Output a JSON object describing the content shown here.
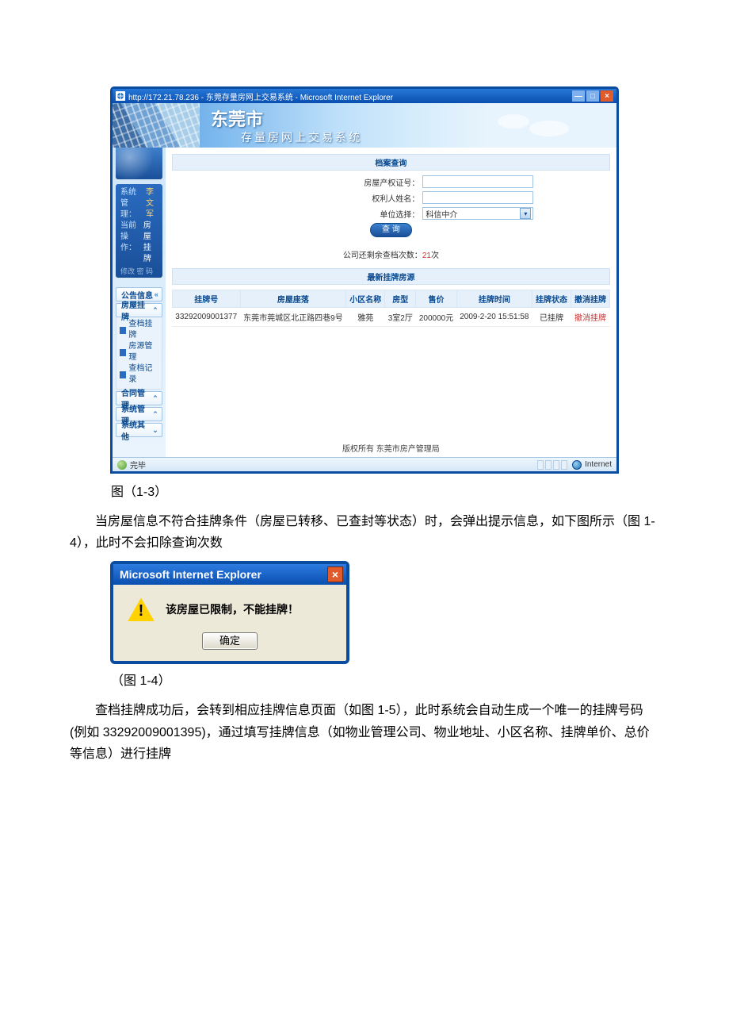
{
  "ie_window": {
    "title": "http://172.21.78.236 - 东莞存量房网上交易系统 - Microsoft Internet Explorer",
    "minimize": "—",
    "maximize": "□",
    "close": "×"
  },
  "app_header": {
    "city": "东莞市",
    "system": "存量房网上交易系统"
  },
  "sidebar": {
    "sys_mgr_label": "系统管理：",
    "sys_mgr_user": "李文军",
    "cur_op_label": "当前操作：",
    "cur_op_val": "房屋挂牌",
    "faint": "修改 密 码",
    "collapse": "«",
    "chev_up": "⌃",
    "chev_down": "⌄",
    "nav": {
      "notice": "公告信息",
      "listing": "房屋挂牌",
      "contract": "合同管理",
      "sysmgmt": "系统管理",
      "sysother": "系统其他"
    },
    "sub": {
      "a": "查档挂牌",
      "b": "房源管理",
      "c": "查档记录"
    }
  },
  "main": {
    "archive_query": "档案查询",
    "latest_listing": "最新挂牌房源",
    "labels": {
      "cert": "房屋产权证号：",
      "owner": "权利人姓名：",
      "unit": "单位选择："
    },
    "unit_value": "科信中介",
    "btn_query": "查 询",
    "remain_prefix": "公司还剩余查档次数：",
    "remain_count": "21",
    "remain_suffix": "次"
  },
  "table": {
    "headers": {
      "no": "挂牌号",
      "addr": "房屋座落",
      "area": "小区名称",
      "type": "房型",
      "price": "售价",
      "time": "挂牌时间",
      "status": "挂牌状态",
      "cancel": "撤消挂牌"
    },
    "row": {
      "no": "33292009001377",
      "addr": "东莞市莞城区北正路四巷9号",
      "area": "雅苑",
      "type": "3室2厅",
      "price": "200000元",
      "time": "2009-2-20 15:51:58",
      "status": "已挂牌",
      "cancel": "撤消挂牌"
    }
  },
  "copyright": "版权所有 东莞市房产管理局",
  "status_bar": {
    "done": "完毕",
    "zone": "Internet"
  },
  "captions": {
    "fig13": "图（1-3）",
    "fig14": "（图 1-4）"
  },
  "paragraphs": {
    "p1_a": "当房屋信息不符合挂牌条件（房屋已转移、已查封等状态）时，会弹出提示信息，如下图所示（图 1-4），此时不会扣除查询次数",
    "p2": "查档挂牌成功后，会转到相应挂牌信息页面（如图 1-5），此时系统会自动生成一个唯一的挂牌号码(例如 33292009001395)，通过填写挂牌信息（如物业管理公司、物业地址、小区名称、挂牌单价、总价等信息）进行挂牌"
  },
  "dialog": {
    "title": "Microsoft Internet Explorer",
    "close": "×",
    "excl": "!",
    "message": "该房屋已限制，不能挂牌！",
    "ok": "确定"
  }
}
